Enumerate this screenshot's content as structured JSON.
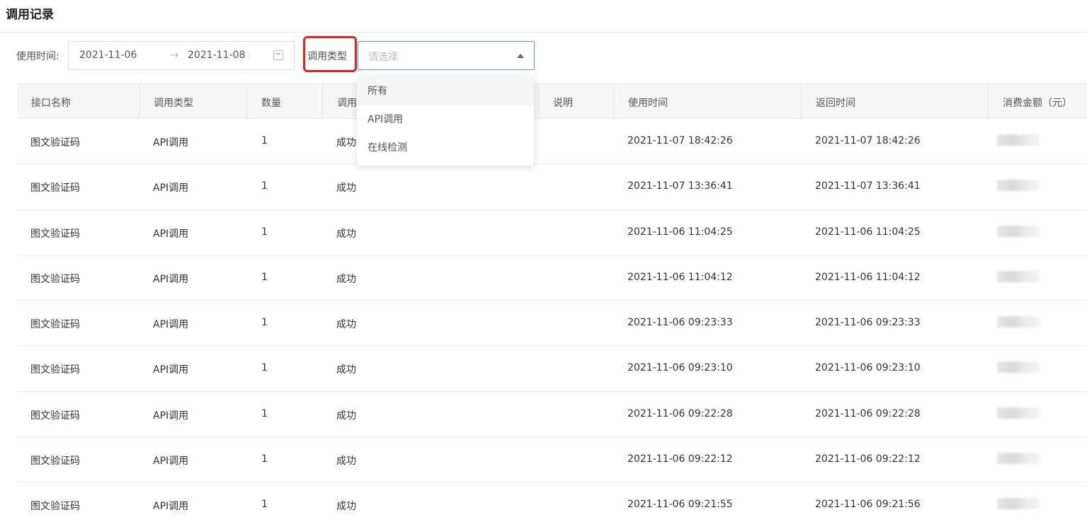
{
  "page": {
    "title": "调用记录"
  },
  "filters": {
    "time_label": "使用时间:",
    "date_start": "2021-11-06",
    "date_separator": "→",
    "date_end": "2021-11-08",
    "type_label": "调用类型",
    "type_placeholder": "请选择"
  },
  "dropdown": {
    "options": [
      "所有",
      "API调用",
      "在线检测"
    ]
  },
  "table": {
    "headers": [
      "接口名称",
      "调用类型",
      "数量",
      "调用",
      "说明",
      "使用时间",
      "返回时间",
      "消费金额（元）"
    ],
    "rows": [
      {
        "name": "图文验证码",
        "type": "API调用",
        "count": "1",
        "status": "成功",
        "use_time": "2021-11-07 18:42:26",
        "return_time": "2021-11-07 18:42:26"
      },
      {
        "name": "图文验证码",
        "type": "API调用",
        "count": "1",
        "status": "成功",
        "use_time": "2021-11-07 13:36:41",
        "return_time": "2021-11-07 13:36:41"
      },
      {
        "name": "图文验证码",
        "type": "API调用",
        "count": "1",
        "status": "成功",
        "use_time": "2021-11-06 11:04:25",
        "return_time": "2021-11-06 11:04:25"
      },
      {
        "name": "图文验证码",
        "type": "API调用",
        "count": "1",
        "status": "成功",
        "use_time": "2021-11-06 11:04:12",
        "return_time": "2021-11-06 11:04:12"
      },
      {
        "name": "图文验证码",
        "type": "API调用",
        "count": "1",
        "status": "成功",
        "use_time": "2021-11-06 09:23:33",
        "return_time": "2021-11-06 09:23:33"
      },
      {
        "name": "图文验证码",
        "type": "API调用",
        "count": "1",
        "status": "成功",
        "use_time": "2021-11-06 09:23:10",
        "return_time": "2021-11-06 09:23:10"
      },
      {
        "name": "图文验证码",
        "type": "API调用",
        "count": "1",
        "status": "成功",
        "use_time": "2021-11-06 09:22:28",
        "return_time": "2021-11-06 09:22:28"
      },
      {
        "name": "图文验证码",
        "type": "API调用",
        "count": "1",
        "status": "成功",
        "use_time": "2021-11-06 09:22:12",
        "return_time": "2021-11-06 09:22:12"
      },
      {
        "name": "图文验证码",
        "type": "API调用",
        "count": "1",
        "status": "成功",
        "use_time": "2021-11-06 09:21:55",
        "return_time": "2021-11-06 09:21:56"
      }
    ]
  },
  "icons": {
    "date_picker": "calendar-icon",
    "select": "caret-up-icon"
  },
  "colors": {
    "highlight_box": "#e8201b",
    "select_border": "#5b8ff9"
  }
}
